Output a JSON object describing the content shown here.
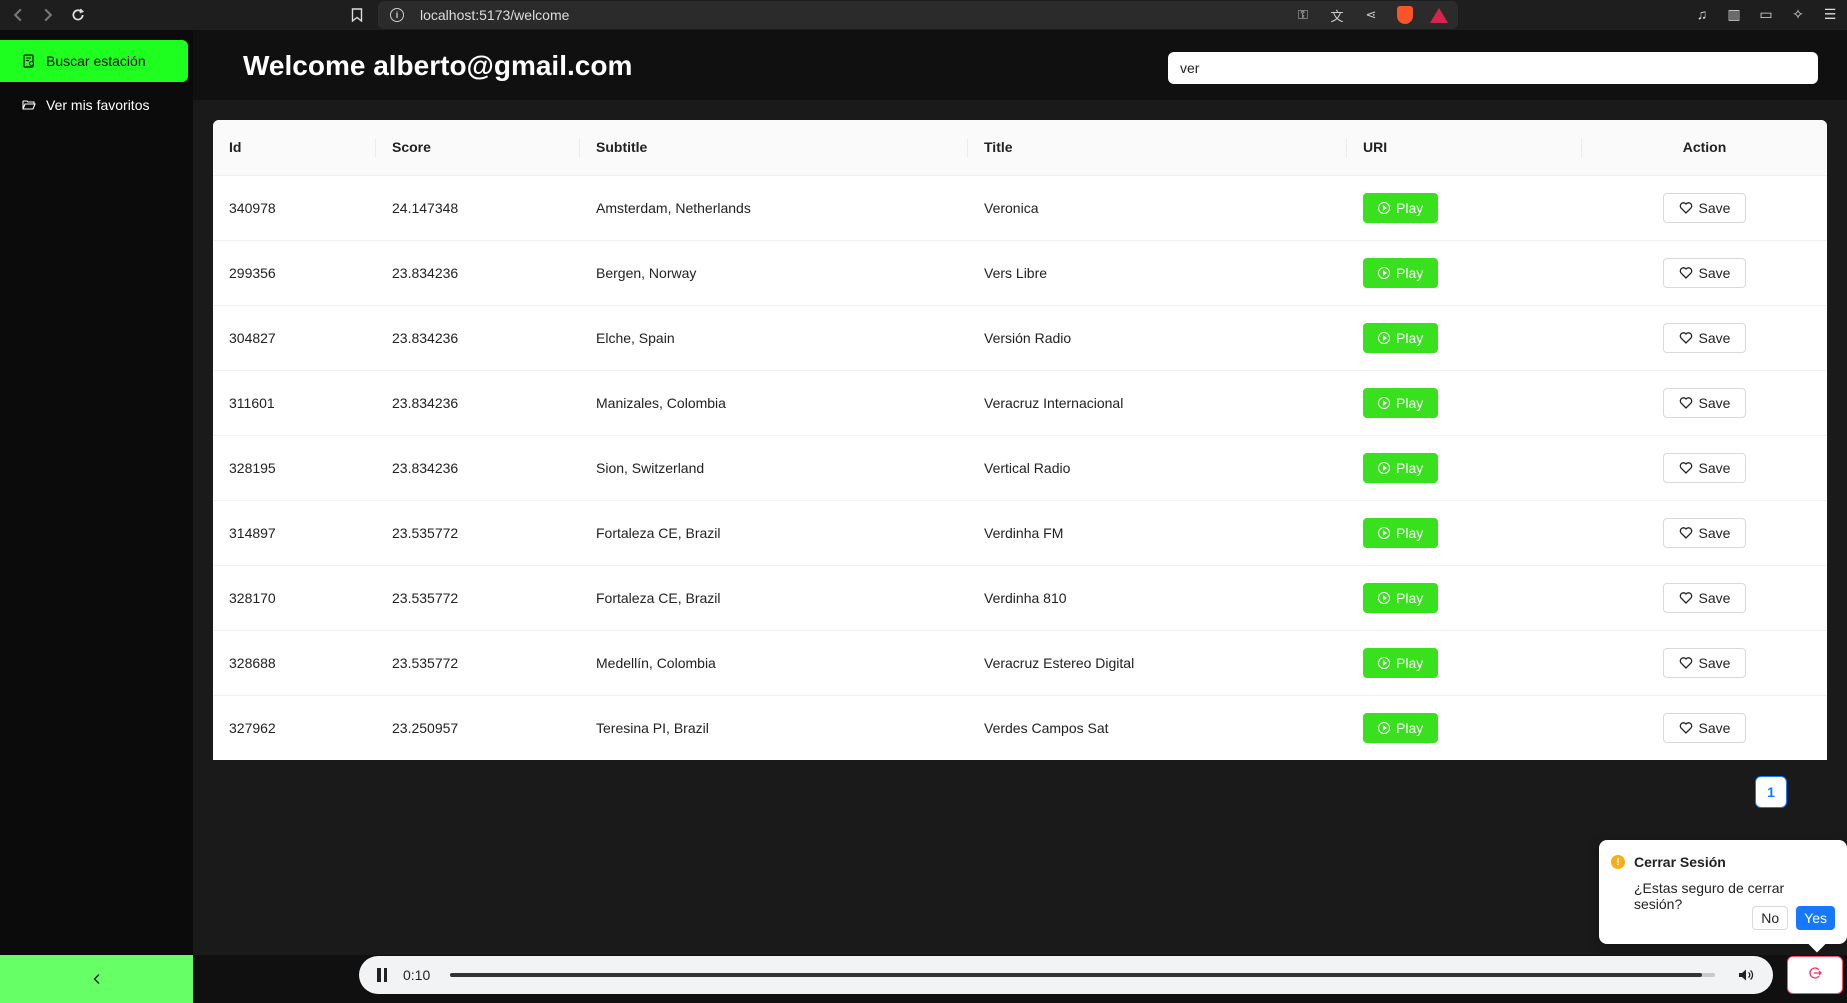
{
  "browser": {
    "url": "localhost:5173/welcome"
  },
  "sidebar": {
    "items": [
      {
        "label": "Buscar estación",
        "icon": "search-list-icon",
        "active": true
      },
      {
        "label": "Ver mis favoritos",
        "icon": "folder-open-icon",
        "active": false
      }
    ],
    "collapse_icon": "chevron-left-icon"
  },
  "header": {
    "welcome": "Welcome alberto@gmail.com",
    "search_value": "ver"
  },
  "table": {
    "columns": [
      "Id",
      "Score",
      "Subtitle",
      "Title",
      "URI",
      "Action"
    ],
    "play_label": "Play",
    "save_label": "Save",
    "rows": [
      {
        "id": "340978",
        "score": "24.147348",
        "subtitle": "Amsterdam, Netherlands",
        "title": "Veronica"
      },
      {
        "id": "299356",
        "score": "23.834236",
        "subtitle": "Bergen, Norway",
        "title": "Vers Libre"
      },
      {
        "id": "304827",
        "score": "23.834236",
        "subtitle": "Elche, Spain",
        "title": "Versión Radio"
      },
      {
        "id": "311601",
        "score": "23.834236",
        "subtitle": "Manizales, Colombia",
        "title": "Veracruz Internacional"
      },
      {
        "id": "328195",
        "score": "23.834236",
        "subtitle": "Sion, Switzerland",
        "title": "Vertical Radio"
      },
      {
        "id": "314897",
        "score": "23.535772",
        "subtitle": "Fortaleza CE, Brazil",
        "title": "Verdinha FM"
      },
      {
        "id": "328170",
        "score": "23.535772",
        "subtitle": "Fortaleza CE, Brazil",
        "title": "Verdinha 810"
      },
      {
        "id": "328688",
        "score": "23.535772",
        "subtitle": "Medellín, Colombia",
        "title": "Veracruz Estereo Digital"
      },
      {
        "id": "327962",
        "score": "23.250957",
        "subtitle": "Teresina PI, Brazil",
        "title": "Verdes Campos Sat"
      }
    ]
  },
  "pagination": {
    "current_page": "1"
  },
  "popconfirm": {
    "title": "Cerrar Sesión",
    "description": "¿Estas seguro de cerrar sesión?",
    "no_label": "No",
    "yes_label": "Yes"
  },
  "player": {
    "time": "0:10",
    "progress": 0.99,
    "state": "playing"
  },
  "colors": {
    "accent_green": "#1fff1f",
    "play_green": "#38e01e",
    "primary_blue": "#1677ff",
    "logout_red": "#ff2d55"
  }
}
